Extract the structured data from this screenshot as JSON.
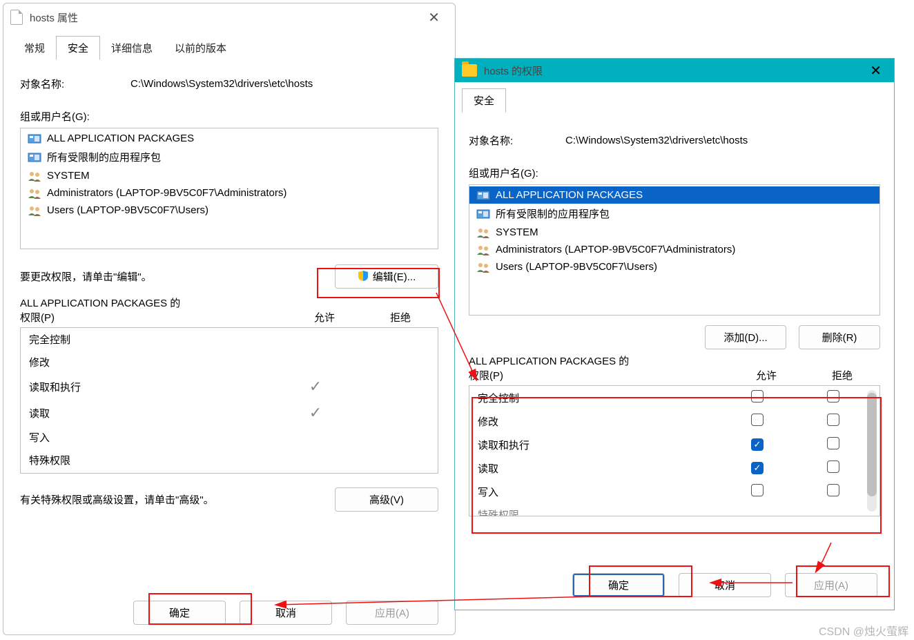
{
  "watermark": "CSDN @烛火萤辉",
  "win1": {
    "title": "hosts 属性",
    "tabs": [
      "常规",
      "安全",
      "详细信息",
      "以前的版本"
    ],
    "active_tab": 1,
    "object_label": "对象名称:",
    "object_value": "C:\\Windows\\System32\\drivers\\etc\\hosts",
    "groups_label": "组或用户名(G):",
    "groups": [
      "ALL APPLICATION PACKAGES",
      "所有受限制的应用程序包",
      "SYSTEM",
      "Administrators (LAPTOP-9BV5C0F7\\Administrators)",
      "Users (LAPTOP-9BV5C0F7\\Users)"
    ],
    "edit_hint": "要更改权限，请单击\"编辑\"。",
    "edit_btn": "编辑(E)...",
    "perm_title_prefix": "ALL APPLICATION PACKAGES 的",
    "perm_title_line2": "权限(P)",
    "col_allow": "允许",
    "col_deny": "拒绝",
    "perms": [
      {
        "name": "完全控制",
        "allow": false,
        "deny": null
      },
      {
        "name": "修改",
        "allow": false,
        "deny": null
      },
      {
        "name": "读取和执行",
        "allow": true,
        "deny": null
      },
      {
        "name": "读取",
        "allow": true,
        "deny": null
      },
      {
        "name": "写入",
        "allow": false,
        "deny": null
      },
      {
        "name": "特殊权限",
        "allow": false,
        "deny": null
      }
    ],
    "adv_hint": "有关特殊权限或高级设置，请单击\"高级\"。",
    "adv_btn": "高级(V)",
    "ok": "确定",
    "cancel": "取消",
    "apply": "应用(A)"
  },
  "win2": {
    "title": "hosts 的权限",
    "tabs": [
      "安全"
    ],
    "active_tab": 0,
    "object_label": "对象名称:",
    "object_value": "C:\\Windows\\System32\\drivers\\etc\\hosts",
    "groups_label": "组或用户名(G):",
    "groups": [
      "ALL APPLICATION PACKAGES",
      "所有受限制的应用程序包",
      "SYSTEM",
      "Administrators (LAPTOP-9BV5C0F7\\Administrators)",
      "Users (LAPTOP-9BV5C0F7\\Users)"
    ],
    "selected_group": 0,
    "add_btn": "添加(D)...",
    "remove_btn": "删除(R)",
    "perm_title_prefix": "ALL APPLICATION PACKAGES 的",
    "perm_title_line2": "权限(P)",
    "col_allow": "允许",
    "col_deny": "拒绝",
    "perms": [
      {
        "name": "完全控制",
        "allow": false,
        "deny": false
      },
      {
        "name": "修改",
        "allow": false,
        "deny": false
      },
      {
        "name": "读取和执行",
        "allow": true,
        "deny": false
      },
      {
        "name": "读取",
        "allow": true,
        "deny": false
      },
      {
        "name": "写入",
        "allow": false,
        "deny": false
      },
      {
        "name": "特殊权限",
        "allow": false,
        "deny": false
      }
    ],
    "ok": "确定",
    "cancel": "取消",
    "apply": "应用(A)"
  }
}
